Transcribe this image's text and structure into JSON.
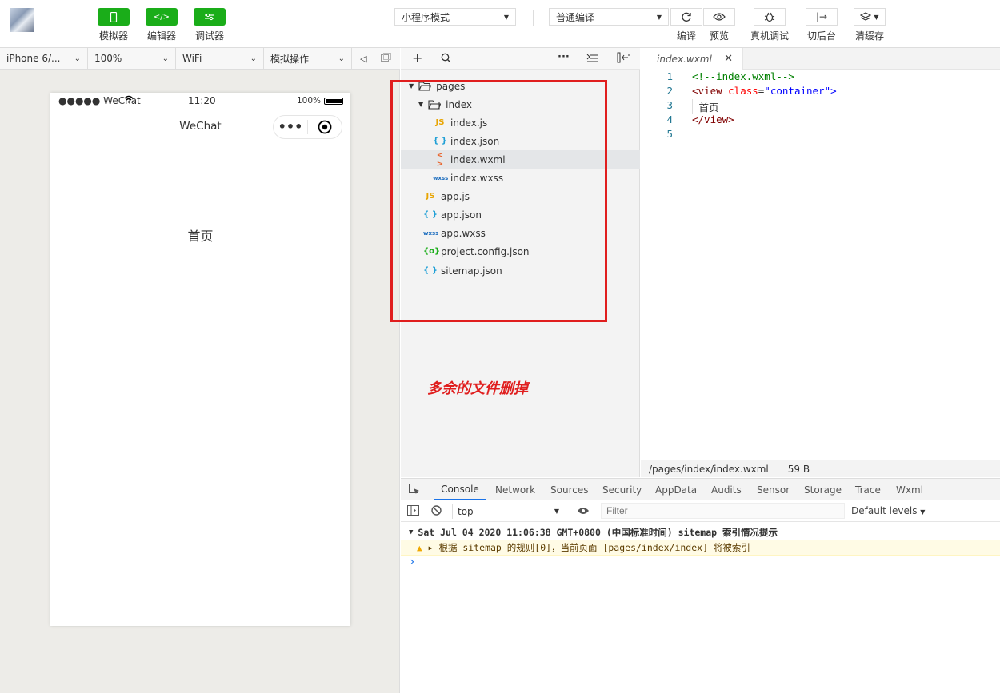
{
  "toolbar": {
    "simulator_label": "模拟器",
    "editor_label": "编辑器",
    "debugger_label": "调试器",
    "mode_select": "小程序模式",
    "compile_select": "普通编译",
    "compile_label": "编译",
    "preview_label": "预览",
    "real_debug_label": "真机调试",
    "background_label": "切后台",
    "clear_cache_label": "清缓存"
  },
  "subbar": {
    "device": "iPhone 6/...",
    "zoom": "100%",
    "network": "WiFi",
    "operation": "模拟操作"
  },
  "phone": {
    "signal": "●●●●● WeChat",
    "time": "11:20",
    "battery": "100%",
    "nav_title": "WeChat",
    "capsule_dots": "•••",
    "page_text": "首页"
  },
  "explorer": {
    "items": [
      {
        "label": "pages",
        "type": "folder",
        "depth": 0,
        "icon": "folder-open-icon"
      },
      {
        "label": "index",
        "type": "folder",
        "depth": 1,
        "icon": "folder-open-icon"
      },
      {
        "label": "index.js",
        "type": "js",
        "depth": 2,
        "icon_text": "JS"
      },
      {
        "label": "index.json",
        "type": "json",
        "depth": 2,
        "icon_text": "{ }"
      },
      {
        "label": "index.wxml",
        "type": "wxml",
        "depth": 2,
        "icon_text": "< >"
      },
      {
        "label": "index.wxss",
        "type": "wxss",
        "depth": 2,
        "icon_text": "wxss"
      },
      {
        "label": "app.js",
        "type": "js",
        "depth": 1,
        "icon_text": "JS"
      },
      {
        "label": "app.json",
        "type": "json",
        "depth": 1,
        "icon_text": "{ }"
      },
      {
        "label": "app.wxss",
        "type": "wxss",
        "depth": 1,
        "icon_text": "wxss"
      },
      {
        "label": "project.config.json",
        "type": "config",
        "depth": 1,
        "icon_text": "{o}"
      },
      {
        "label": "sitemap.json",
        "type": "json",
        "depth": 1,
        "icon_text": "{ }"
      }
    ],
    "annotation": "多余的文件删掉"
  },
  "editor": {
    "tab": "index.wxml",
    "lines": [
      "1",
      "2",
      "3",
      "4",
      "5"
    ],
    "code": {
      "l1": "<!--index.wxml-->",
      "l2a": "<view ",
      "l2b": "class",
      "l2c": "=",
      "l2d": "\"container\"",
      "l2e": ">",
      "l3": " 首页",
      "l4": "</view>"
    },
    "status_path": "/pages/index/index.wxml",
    "status_size": "59 B"
  },
  "devtools": {
    "tabs": [
      "Console",
      "Network",
      "Sources",
      "Security",
      "AppData",
      "Audits",
      "Sensor",
      "Storage",
      "Trace",
      "Wxml"
    ],
    "context": "top",
    "filter_placeholder": "Filter",
    "levels": "Default levels",
    "log_group": "Sat Jul 04 2020 11:06:38 GMT+0800 (中国标准时间) sitemap 索引情况提示",
    "log_warning": "根据 sitemap 的规则[0]，当前页面 [pages/index/index] 将被索引",
    "prompt": "›"
  },
  "colors": {
    "accent_green": "#1aad19",
    "annotation_red": "#e01e1e",
    "tab_active_blue": "#1a73e8"
  }
}
